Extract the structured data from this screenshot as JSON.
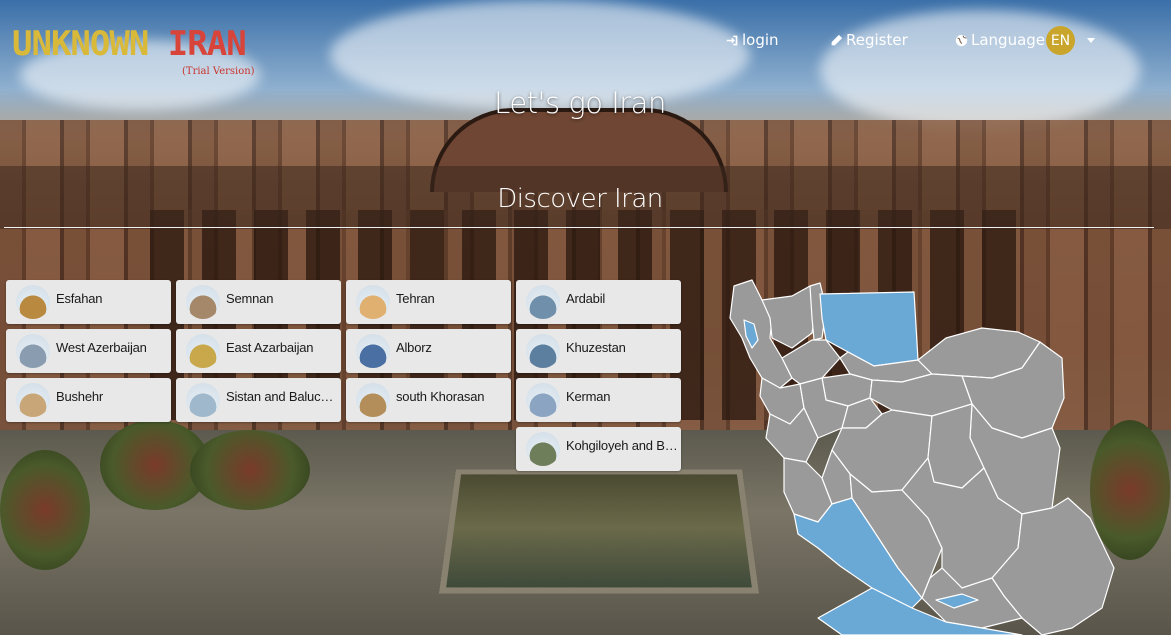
{
  "logo": {
    "word1": "UNKNOWN",
    "word2": "IRAN",
    "subtitle": "(Trial Version)"
  },
  "nav": {
    "login": "login",
    "register": "Register",
    "language": "Language",
    "language_code": "EN"
  },
  "hero": {
    "title": "Let's go Iran"
  },
  "section": {
    "title": "Discover Iran"
  },
  "provinces": [
    {
      "name": "Esfahan",
      "thumb_color": "#b8893f"
    },
    {
      "name": "Semnan",
      "thumb_color": "#a5876a"
    },
    {
      "name": "Tehran",
      "thumb_color": "#e0b070"
    },
    {
      "name": "Ardabil",
      "thumb_color": "#6f8faa"
    },
    {
      "name": "West Azerbaijan",
      "thumb_color": "#8a9db0"
    },
    {
      "name": "East Azarbaijan",
      "thumb_color": "#c8a84a"
    },
    {
      "name": "Alborz",
      "thumb_color": "#4a6fa3"
    },
    {
      "name": "Khuzestan",
      "thumb_color": "#5d7f9f"
    },
    {
      "name": "Bushehr",
      "thumb_color": "#c9a677"
    },
    {
      "name": "Sistan and Baluchestan",
      "thumb_color": "#9fb8cc"
    },
    {
      "name": "south Khorasan",
      "thumb_color": "#b38e5a"
    },
    {
      "name": "Kerman",
      "thumb_color": "#8aa4c2"
    },
    {
      "name": "Kohgiloyeh and Boyer-Ahmad",
      "thumb_color": "#6e7d5a"
    }
  ],
  "map": {
    "highlight_color": "#6aa8d6",
    "base_color": "#9a9a9a",
    "border_color": "#ffffff"
  }
}
